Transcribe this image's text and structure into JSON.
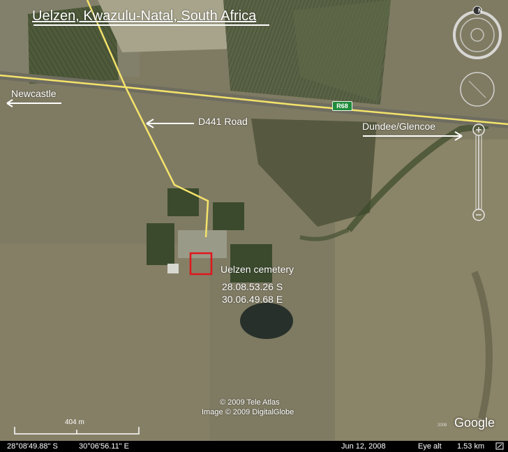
{
  "title": "Uelzen, Kwazulu-Natal, South Africa",
  "labels": {
    "newcastle": "Newcastle",
    "d441": "D441 Road",
    "dundee": "Dundee/Glencoe",
    "route_shield": "R68"
  },
  "cemetery": {
    "name": "Uelzen cemetery",
    "lat": "28.08.53.26 S",
    "lon": "30.06.49.68 E"
  },
  "copyright": {
    "line1": "© 2009 Tele Atlas",
    "line2": "Image © 2009 DigitalGlobe"
  },
  "scale": {
    "label": "404 m"
  },
  "google_logo": "Google",
  "data_year": "2008",
  "status_bar": {
    "lat": "28°08'49.88\" S",
    "lon": "30°06'56.11\" E",
    "date": "Jun 12, 2008",
    "eye_label": "Eye alt",
    "eye_value": "1.53 km"
  },
  "nav_controls": {
    "north_label": "N"
  },
  "colors": {
    "road_yellow": "#f4e36b",
    "cemetery_box": "#e0161c",
    "annotation_white": "#ffffff",
    "shield_green": "#1e8a3a",
    "status_bar": "#000000"
  }
}
